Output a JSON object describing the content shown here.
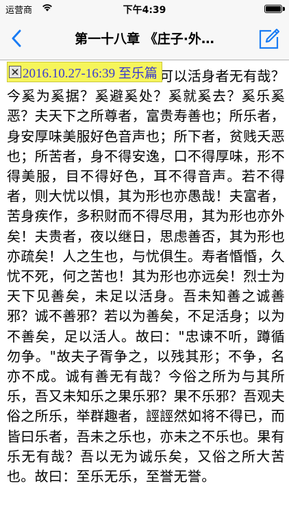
{
  "status_bar": {
    "carrier": "运营商",
    "time": "下午4:39"
  },
  "nav": {
    "title": "第一十八章 《庄子·外…"
  },
  "note": {
    "label": "2016.10.27-16:39 至乐篇"
  },
  "article": {
    "text": "天下有至乐无有哉？有可以活身者无有哉？今奚为奚据？奚避奚处？奚就奚去？奚乐奚恶？夫天下之所尊者，富贵寿善也；所乐者，身安厚味美服好色音声也；所下者，贫贱夭恶也；所苦者，身不得安逸，口不得厚味，形不得美服，目不得好色，耳不得音声。若不得者，则大忧以惧，其为形也亦愚哉！夫富者，苦身疾作，多积财而不得尽用，其为形也亦外矣！夫贵者，夜以继日，思虑善否，其为形也亦疏矣！人之生也，与忧俱生。寿者惛惛，久忧不死，何之苦也！其为形也亦远矣！烈士为天下见善矣，未足以活身。吾未知善之诚善邪？诚不善邪？若以为善矣，不足活身；以为不善矣，足以活人。故曰：\"忠谏不听，蹲循勿争。\"故夫子胥争之，以残其形；不争，名亦不成。诚有善无有哉？今俗之所为与其所乐，吾又未知乐之果乐邪？果不乐邪？吾观夫俗之所乐，举群趣者，誙誙然如将不得已，而皆曰乐者，吾未之乐也，亦未之不乐也。果有乐无有哉？吾以无为诚乐矣，又俗之所大苦也。故曰：至乐无乐，至誉无誉。"
  }
}
